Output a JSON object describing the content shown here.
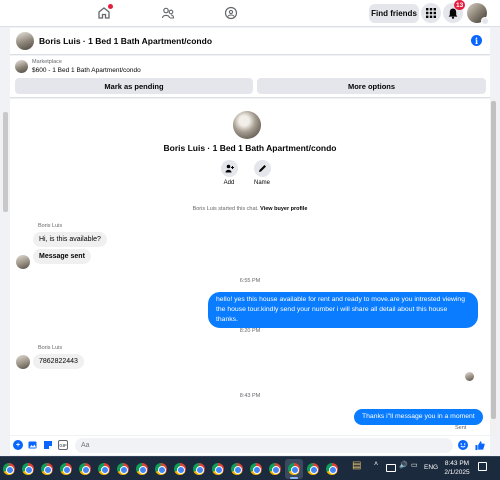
{
  "nav": {
    "find_friends": "Find friends",
    "notification_count": "13"
  },
  "chat": {
    "title": "Boris Luis · 1 Bed 1 Bath Apartment/condo",
    "contact_name": "Boris Luis"
  },
  "marketplace": {
    "label": "Marketplace",
    "listing": "$600 - 1 Bed 1 Bath Apartment/condo",
    "mark_pending": "Mark as pending",
    "more_options": "More options"
  },
  "profile": {
    "name": "Boris Luis · 1 Bed 1 Bath Apartment/condo",
    "actions": [
      {
        "label": "Add"
      },
      {
        "label": "Name"
      }
    ]
  },
  "thread": {
    "started_text": "Boris Luis started this chat.",
    "view_profile": "View buyer profile",
    "messages": [
      {
        "sender": "Boris Luis",
        "text": "Hi, is this available?"
      },
      {
        "text": "Message sent"
      },
      {
        "time": "6:55 PM"
      },
      {
        "text": "hello! yes this house available for rent and ready to move.are you intrested viewing the house tour.kindly send your number i will share all detail about this house thanks."
      },
      {
        "time": "8:20 PM"
      },
      {
        "sender": "Boris Luis",
        "text": "7862822443"
      },
      {
        "time": "8:43 PM"
      },
      {
        "text": "Thanks i\"ll message you in a moment"
      }
    ],
    "status": "Sent"
  },
  "composer": {
    "placeholder": "Aa"
  },
  "taskbar": {
    "language": "ENG",
    "time": "8:43 PM",
    "date": "2/1/2025"
  },
  "colors": {
    "accent": "#0866ff",
    "outgoing_bubble": "#0a7cff",
    "badge": "#e41e3f"
  },
  "icons": [
    "home-icon",
    "friends-icon",
    "groups-icon",
    "menu-grid-icon",
    "bell-icon",
    "info-icon",
    "add-person-icon",
    "pencil-icon",
    "plus-icon",
    "image-icon",
    "sticker-icon",
    "gif-icon",
    "emoji-icon",
    "like-icon",
    "chrome-icon",
    "tray-icons"
  ]
}
